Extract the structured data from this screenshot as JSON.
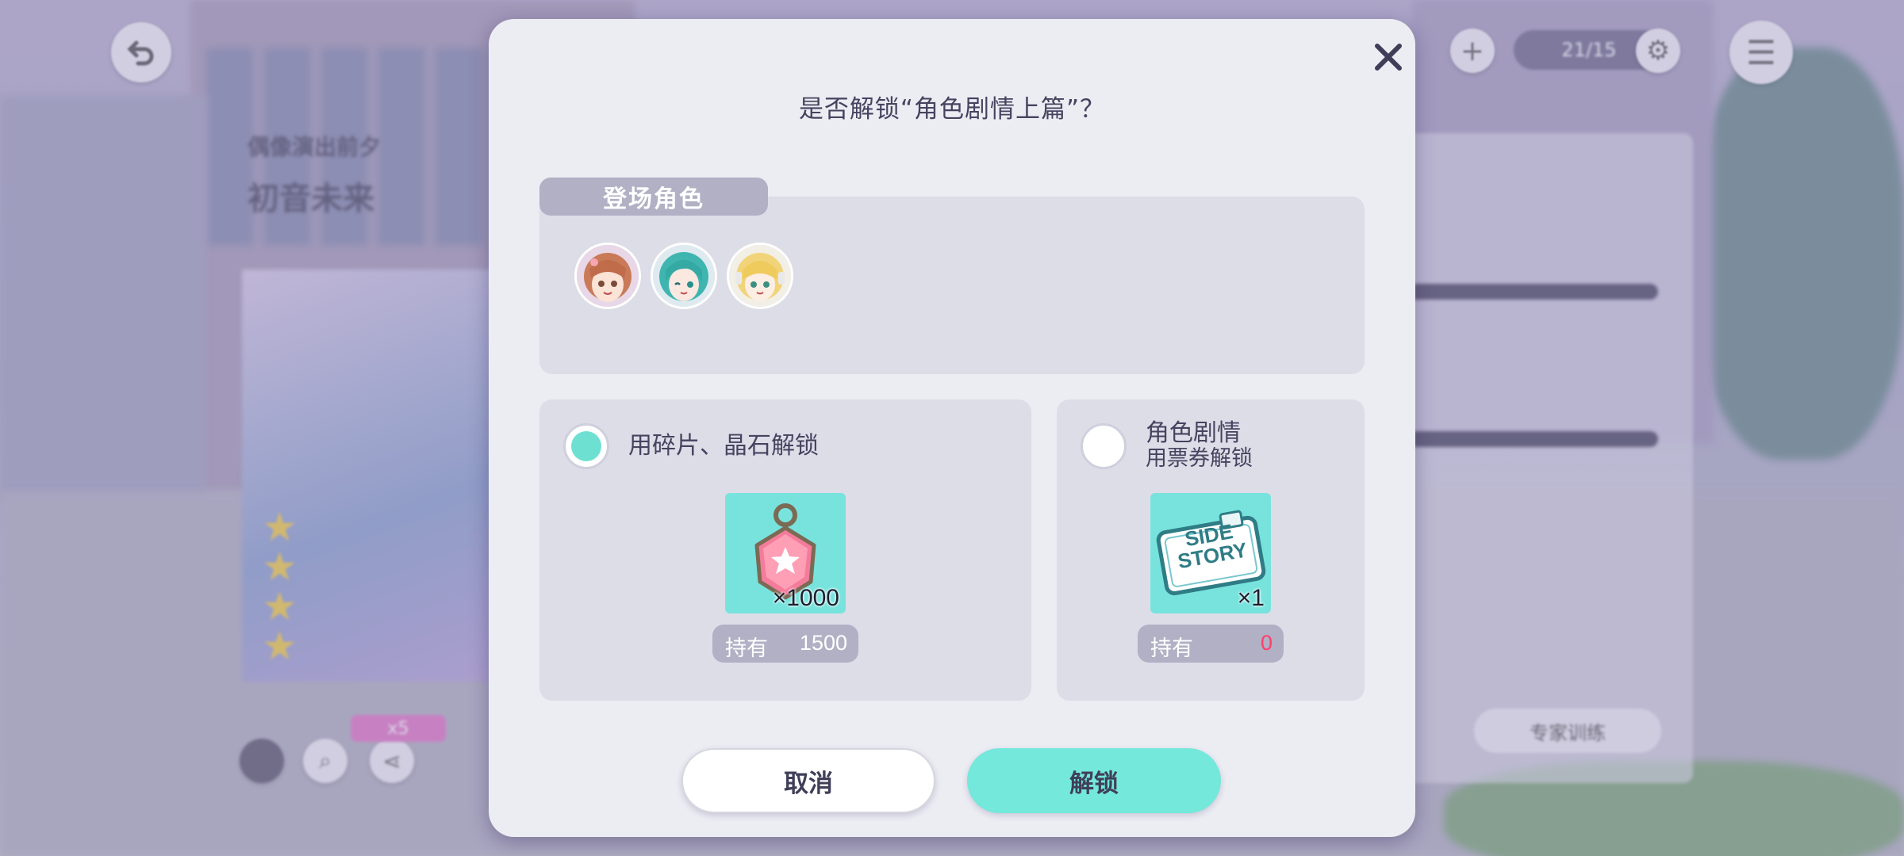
{
  "background": {
    "resource_count": "21/15",
    "char_name_small": "偶像演出前夕",
    "char_name": "初音未来",
    "right_button": "专家训练",
    "badge_value": "x5"
  },
  "dialog": {
    "title": "是否解锁“角色剧情上篇”？",
    "cast_label": "登场角色",
    "option1": {
      "label": "用碎片、晶石解锁",
      "qty": "×1000",
      "own_label": "持有",
      "own_value": "1500",
      "selected": true
    },
    "option2": {
      "label_line1": "角色剧情",
      "label_line2": "用票券解锁",
      "ticket_text1": "SIDE",
      "ticket_text2": "STORY",
      "qty": "×1",
      "own_label": "持有",
      "own_value": "0",
      "selected": false
    },
    "cancel_label": "取消",
    "unlock_label": "解锁"
  },
  "colors": {
    "accent": "#6ee0d2",
    "item_bg": "#78e3dd",
    "insufficient": "#ff3f6c",
    "panel": "#dddde8",
    "tab": "#b1b0c5"
  },
  "icons": {
    "close": "close-icon",
    "back": "back-arrow-icon",
    "plus": "plus-icon",
    "menu": "menu-icon",
    "settings": "gear-icon"
  }
}
